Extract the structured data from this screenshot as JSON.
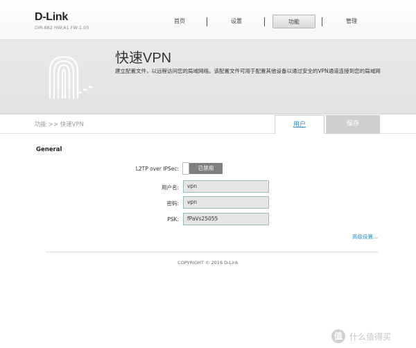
{
  "header": {
    "logo": "D-Link",
    "model": "DIR-882 HW:A1 FW:1.03",
    "nav": [
      {
        "label": "首页",
        "active": false
      },
      {
        "label": "设置",
        "active": false
      },
      {
        "label": "功能",
        "active": true
      },
      {
        "label": "管理",
        "active": false
      }
    ]
  },
  "banner": {
    "title": "快速VPN",
    "description": "建立配置文件，以远程访问您的局域网络。该配置文件可用于配置其他设备以通过安全的VPN通道连接到您的局域网"
  },
  "toolbar": {
    "breadcrumb": "功能 >> 快速VPN",
    "users_label": "用户",
    "save_label": "保存"
  },
  "form": {
    "section_title": "General",
    "l2tp": {
      "label": "L2TP over IPSec:",
      "state": "已禁用"
    },
    "username": {
      "label": "用户名:",
      "value": "vpn"
    },
    "password": {
      "label": "密码:",
      "value": "vpn"
    },
    "psk": {
      "label": "PSK:",
      "value": "fPaVs25055"
    },
    "advanced_label": "高级设置..."
  },
  "footer": {
    "copyright": "COPYRIGHT © 2016 D-Link"
  },
  "watermark": {
    "icon": "值",
    "text": "什么值得买"
  },
  "colors": {
    "accent": "#2a8fc9",
    "field_border": "#8fc3c3",
    "toggle_off": "#7f7f7f",
    "save_disabled": "#cfcfcf"
  }
}
